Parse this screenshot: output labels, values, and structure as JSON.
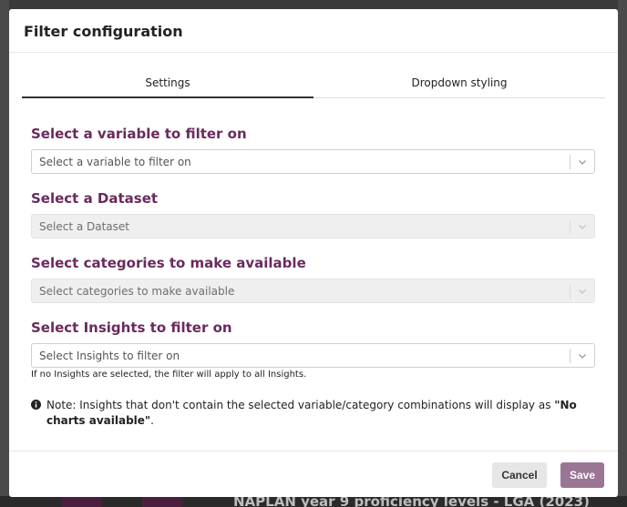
{
  "background": {
    "bottom_text": "NAPLAN year 9 proficiency levels - LGA (2023)"
  },
  "modal": {
    "title": "Filter configuration",
    "tabs": [
      {
        "label": "Settings",
        "active": true
      },
      {
        "label": "Dropdown styling",
        "active": false
      }
    ],
    "fields": [
      {
        "label": "Select a variable to filter on",
        "placeholder": "Select a variable to filter on",
        "disabled": false
      },
      {
        "label": "Select a Dataset",
        "placeholder": "Select a Dataset",
        "disabled": true
      },
      {
        "label": "Select categories to make available",
        "placeholder": "Select categories to make available",
        "disabled": true
      },
      {
        "label": "Select Insights to filter on",
        "placeholder": "Select Insights to filter on",
        "disabled": false
      }
    ],
    "help_text": "If no Insights are selected, the filter will apply to all Insights.",
    "note": {
      "prefix": "Note: Insights that don't contain the selected variable/category combinations will display as ",
      "emphasis": "\"No charts available\"",
      "suffix": "."
    },
    "buttons": {
      "cancel": "Cancel",
      "save": "Save"
    }
  },
  "colors": {
    "label": "#6a2a5e",
    "save_button": "#9b7694"
  },
  "icons": {
    "chevron": "chevron-down-icon",
    "info": "info-circle-icon"
  }
}
